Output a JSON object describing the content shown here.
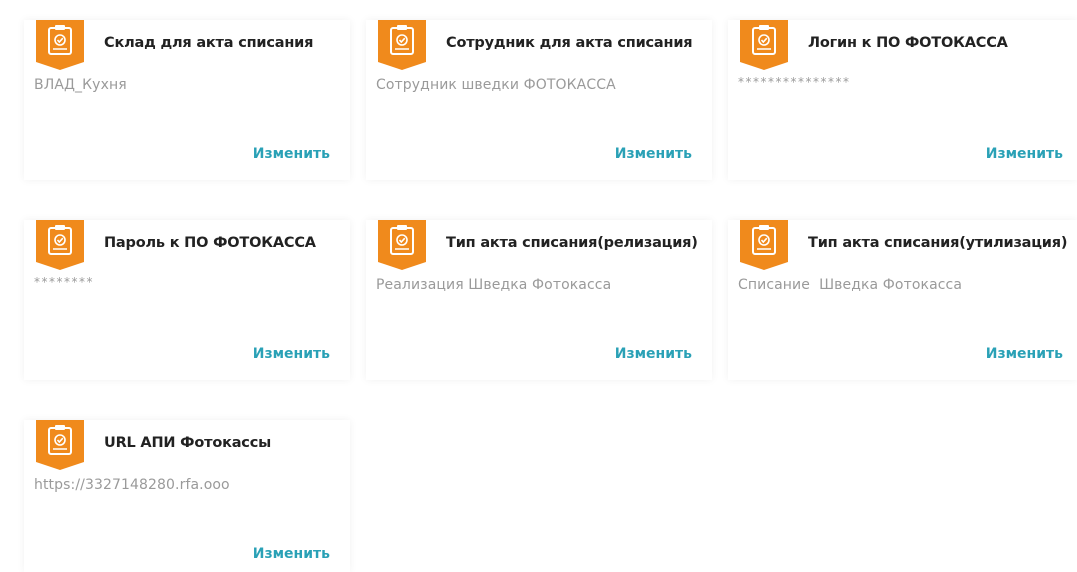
{
  "accent_color": "#f08a1c",
  "link_color": "#2aa1b6",
  "cards": [
    {
      "title": "Склад для акта списания",
      "value": "ВЛАД_Кухня",
      "action": "Изменить",
      "icon": "clipboard-check-icon"
    },
    {
      "title": "Сотрудник для акта списания",
      "value": "Сотрудник шведки ФОТОКАССА",
      "action": "Изменить",
      "icon": "clipboard-check-icon"
    },
    {
      "title": "Логин к ПО ФОТОКАССА",
      "value": "***************",
      "action": "Изменить",
      "icon": "clipboard-check-icon"
    },
    {
      "title": "Пароль к ПО ФОТОКАССА",
      "value": "********",
      "action": "Изменить",
      "icon": "clipboard-check-icon"
    },
    {
      "title": "Тип акта списания(релизация)",
      "value": "Реализация Шведка Фотокасса",
      "action": "Изменить",
      "icon": "clipboard-check-icon"
    },
    {
      "title": "Тип акта списания(утилизация)",
      "value": "Списание  Шведка Фотокасса",
      "action": "Изменить",
      "icon": "clipboard-check-icon"
    },
    {
      "title": "URL АПИ Фотокассы",
      "value": "https://3327148280.rfa.ooo",
      "action": "Изменить",
      "icon": "clipboard-check-icon"
    }
  ]
}
